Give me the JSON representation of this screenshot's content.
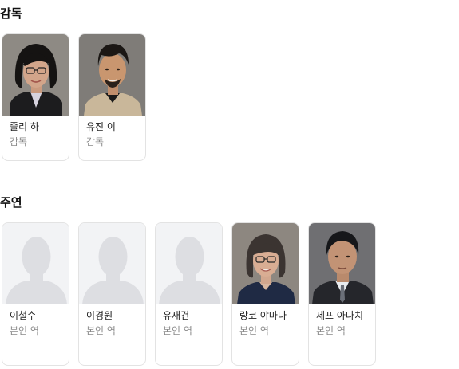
{
  "directors": {
    "title": "감독",
    "people": [
      {
        "name": "줄리 하",
        "role": "감독"
      },
      {
        "name": "유진 이",
        "role": "감독"
      }
    ]
  },
  "cast": {
    "title": "주연",
    "people": [
      {
        "name": "이철수",
        "role": "본인 역"
      },
      {
        "name": "이경원",
        "role": "본인 역"
      },
      {
        "name": "유재건",
        "role": "본인 역"
      },
      {
        "name": "랑코 야마다",
        "role": "본인 역"
      },
      {
        "name": "제프 아다치",
        "role": "본인 역"
      }
    ]
  }
}
